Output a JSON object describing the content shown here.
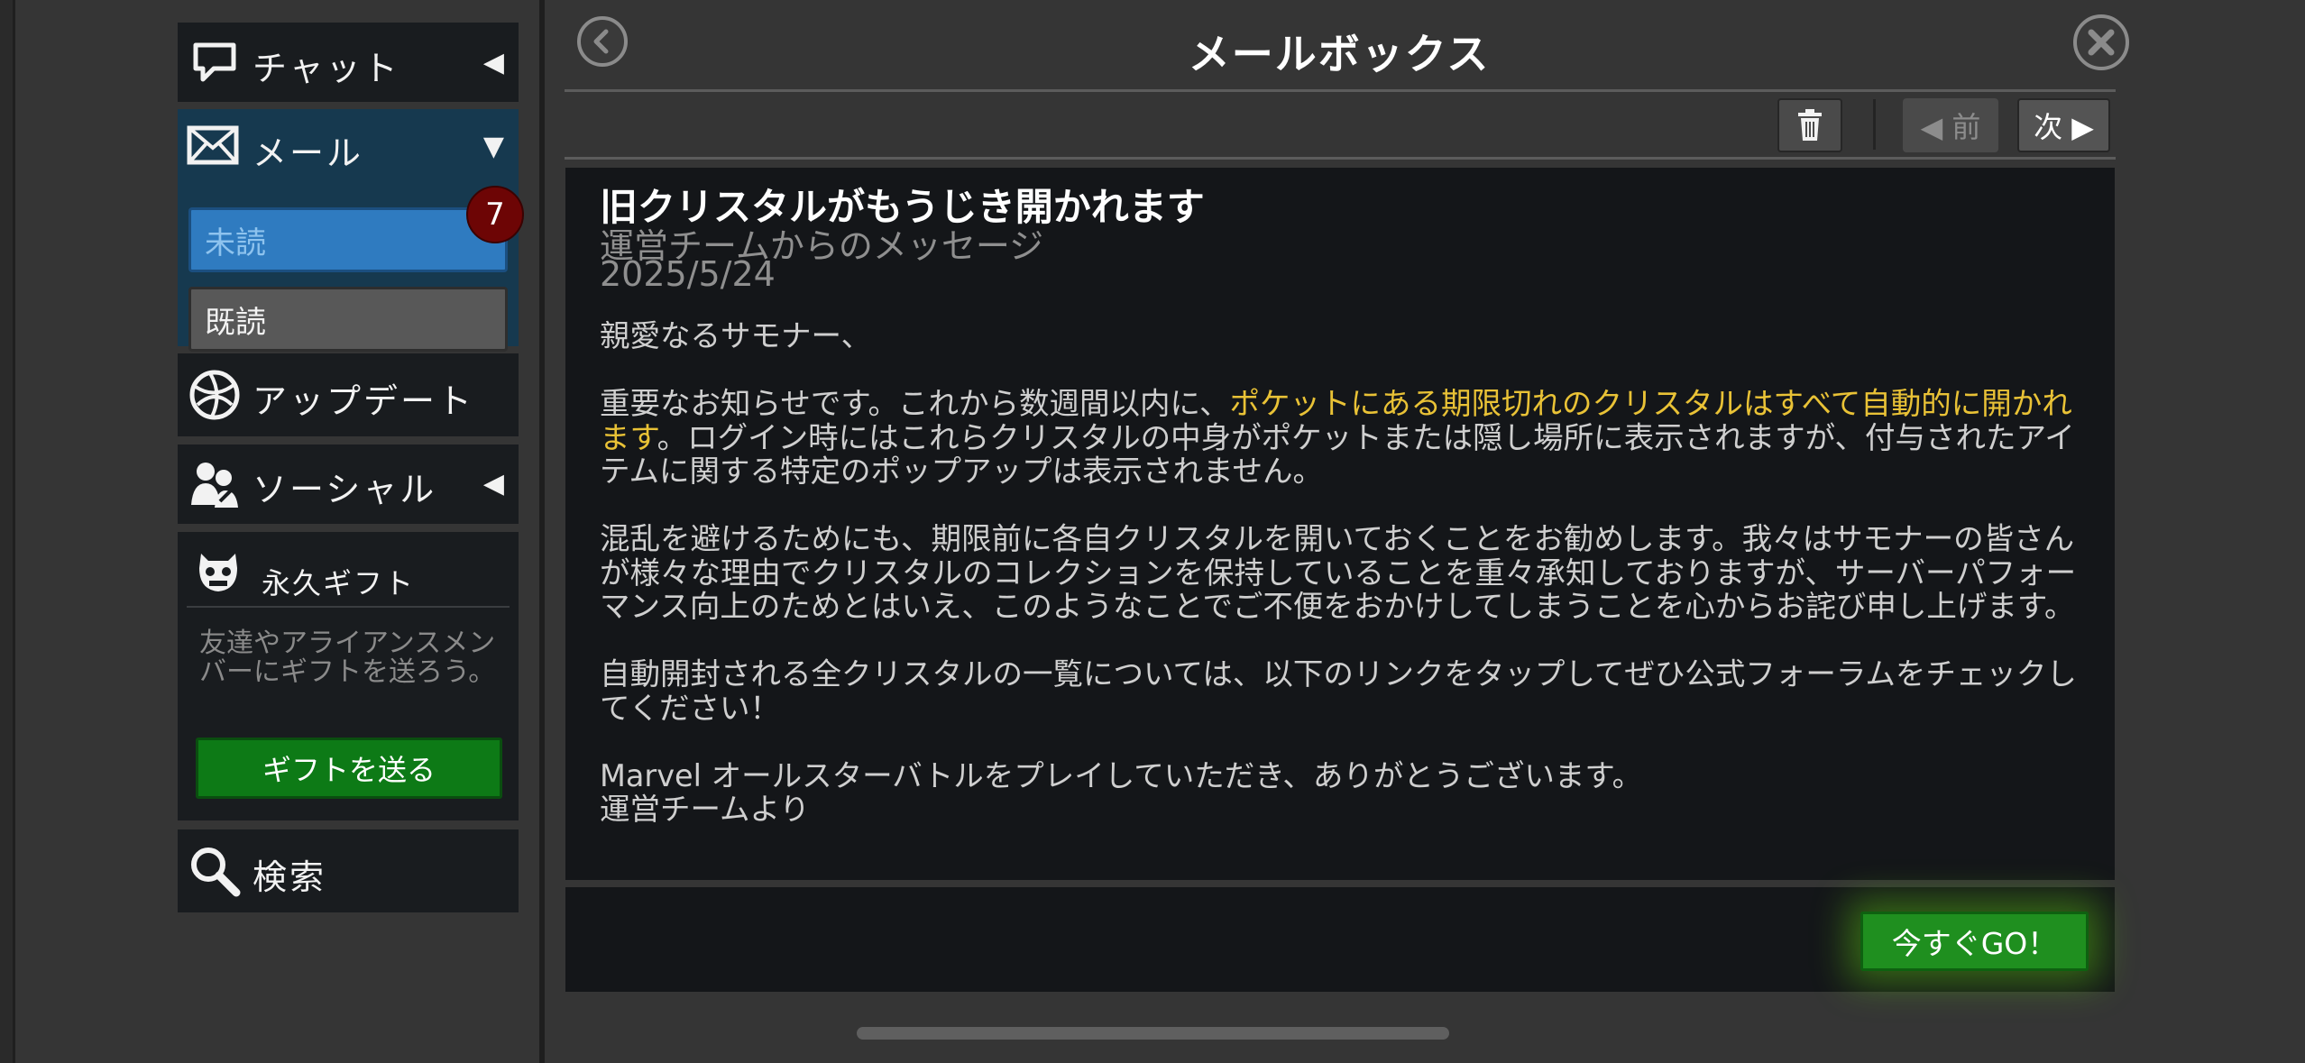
{
  "sidebar": {
    "chat": {
      "label": "チャット",
      "arrow": "◀",
      "icon": "chat-bubble-icon"
    },
    "mail": {
      "label": "メール",
      "arrow": "▼",
      "icon": "envelope-icon",
      "badge": "7",
      "unread_label": "未読",
      "read_label": "既読"
    },
    "update": {
      "label": "アップデート",
      "icon": "globe-icon"
    },
    "social": {
      "label": "ソーシャル",
      "arrow": "◀",
      "icon": "people-icon"
    },
    "gift": {
      "title": "永久ギフト",
      "icon": "creature-face-icon",
      "description": "友達やアライアンスメンバーにギフトを送ろう。",
      "button": "ギフトを送る"
    },
    "search": {
      "label": "検索",
      "icon": "magnifier-icon"
    }
  },
  "header": {
    "title": "メールボックス",
    "back_icon": "back-arrow-icon",
    "close_icon": "close-icon"
  },
  "toolbar": {
    "trash_icon": "trash-icon",
    "prev": "◀ 前",
    "next": "次 ▶"
  },
  "mail": {
    "title": "旧クリスタルがもうじき開かれます",
    "sender": "運営チームからのメッセージ",
    "date": "2025/5/24",
    "greeting": "親愛なるサモナー、",
    "p1_before": "重要なお知らせです。これから数週間以内に、",
    "p1_highlight": "ポケットにある期限切れのクリスタルはすべて自動的に開かれます",
    "p1_after": "。ログイン時にはこれらクリスタルの中身がポケットまたは隠し場所に表示されますが、付与されたアイテムに関する特定のポップアップは表示されません。",
    "p2": "混乱を避けるためにも、期限前に各自クリスタルを開いておくことをお勧めします。我々はサモナーの皆さんが様々な理由でクリスタルのコレクションを保持していることを重々承知しておりますが、サーバーパフォーマンス向上のためとはいえ、このようなことでご不便をおかけしてしまうことを心からお詫び申し上げます。",
    "p3": "自動開封される全クリスタルの一覧については、以下のリンクをタップしてぜひ公式フォーラムをチェックしてください！",
    "p4_line1": "Marvel オールスターバトルをプレイしていただき、ありがとうございます。",
    "p4_line2": "運営チームより"
  },
  "footer": {
    "go_button": "今すぐGO！"
  },
  "colors": {
    "highlight": "#e9c236",
    "unread": "#2f7bc0",
    "badge": "#6d0505",
    "green": "#1f8f1f"
  }
}
